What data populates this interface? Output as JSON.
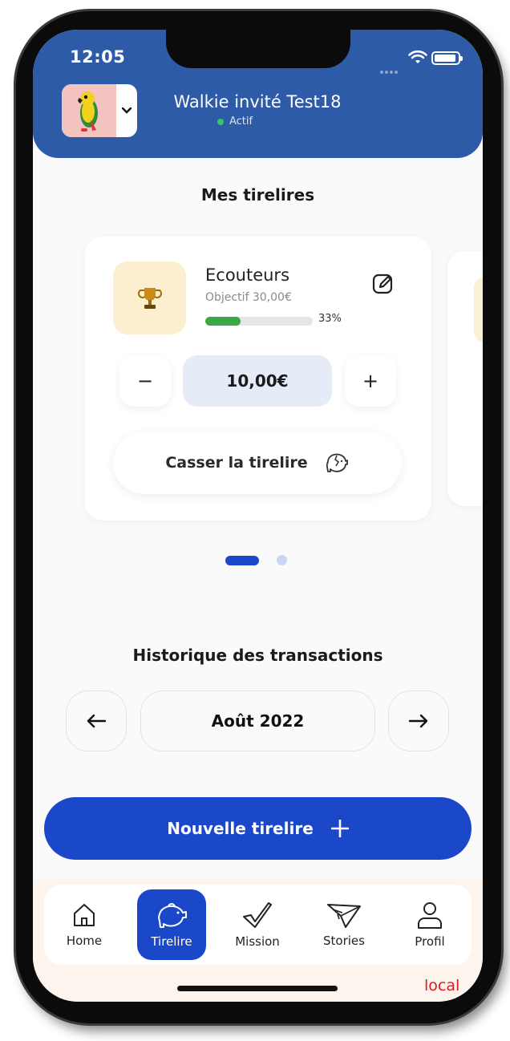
{
  "status_bar": {
    "time": "12:05"
  },
  "header": {
    "user_name": "Walkie invité Test18",
    "status": "Actif"
  },
  "piggy_section": {
    "title": "Mes tirelires",
    "card": {
      "name": "Ecouteurs",
      "objective": "Objectif 30,00€",
      "progress_fraction": 0.33,
      "progress_label": "33%",
      "amount": "10,00€",
      "minus": "−",
      "plus": "+",
      "break_label": "Casser la tirelire"
    },
    "pages": 2,
    "active_page": 1
  },
  "history": {
    "title": "Historique des transactions",
    "month": "Août 2022",
    "prev": "←",
    "next": "→"
  },
  "new_button": {
    "label": "Nouvelle tirelire",
    "icon": "+"
  },
  "tabs": [
    {
      "label": "Home",
      "icon": "house-icon"
    },
    {
      "label": "Tirelire",
      "icon": "piggy-bank-icon",
      "active": true
    },
    {
      "label": "Mission",
      "icon": "checkmark-icon"
    },
    {
      "label": "Stories",
      "icon": "paper-plane-icon"
    },
    {
      "label": "Profil",
      "icon": "person-icon"
    }
  ],
  "env_label": "local",
  "colors": {
    "header": "#2e5ba8",
    "primary": "#1a48c9",
    "progress": "#3aa845",
    "status_dot": "#3cc46a",
    "env": "#e8161b"
  }
}
